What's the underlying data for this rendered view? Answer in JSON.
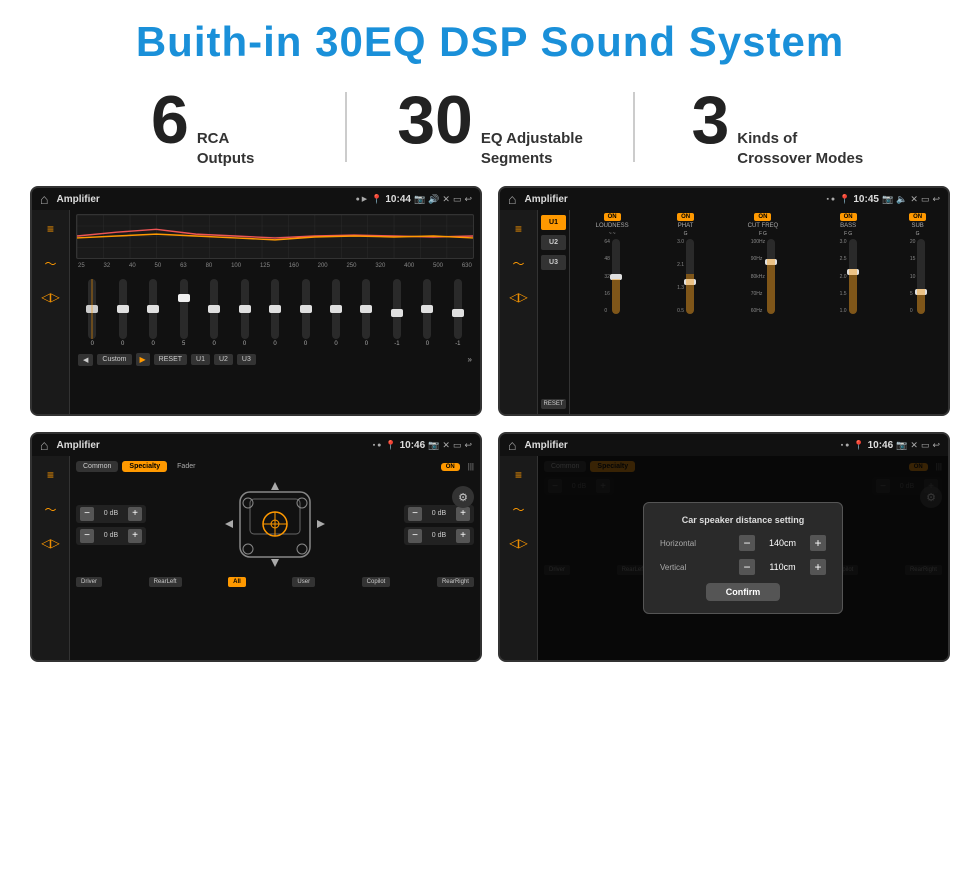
{
  "header": {
    "title": "Buith-in 30EQ DSP Sound System"
  },
  "stats": [
    {
      "number": "6",
      "label": "RCA\nOutputs"
    },
    {
      "number": "30",
      "label": "EQ Adjustable\nSegments"
    },
    {
      "number": "3",
      "label": "Kinds of\nCrossover Modes"
    }
  ],
  "screen1": {
    "statusBar": {
      "title": "Amplifier",
      "time": "10:44"
    },
    "freqLabels": [
      "25",
      "32",
      "40",
      "50",
      "63",
      "80",
      "100",
      "125",
      "160",
      "200",
      "250",
      "320",
      "400",
      "500",
      "630"
    ],
    "sliderValues": [
      "0",
      "0",
      "0",
      "5",
      "0",
      "0",
      "0",
      "0",
      "0",
      "0",
      "-1",
      "0",
      "-1"
    ],
    "preset": "Custom",
    "buttons": [
      "RESET",
      "U1",
      "U2",
      "U3"
    ]
  },
  "screen2": {
    "statusBar": {
      "title": "Amplifier",
      "time": "10:45"
    },
    "presets": [
      "U1",
      "U2",
      "U3"
    ],
    "controls": [
      {
        "label": "LOUDNESS",
        "on": true
      },
      {
        "label": "PHAT",
        "on": true
      },
      {
        "label": "CUT FREQ",
        "on": true
      },
      {
        "label": "BASS",
        "on": true
      },
      {
        "label": "SUB",
        "on": true
      }
    ],
    "resetLabel": "RESET"
  },
  "screen3": {
    "statusBar": {
      "title": "Amplifier",
      "time": "10:46"
    },
    "tabs": [
      "Common",
      "Specialty"
    ],
    "activeTab": "Specialty",
    "faderLabel": "Fader",
    "faderOn": "ON",
    "volumes": [
      "0 dB",
      "0 dB",
      "0 dB",
      "0 dB"
    ],
    "positions": [
      "Driver",
      "RearLeft",
      "All",
      "User",
      "Copilot",
      "RearRight"
    ]
  },
  "screen4": {
    "statusBar": {
      "title": "Amplifier",
      "time": "10:46"
    },
    "tabs": [
      "Common",
      "Specialty"
    ],
    "dialog": {
      "title": "Car speaker distance setting",
      "fields": [
        {
          "label": "Horizontal",
          "value": "140cm"
        },
        {
          "label": "Vertical",
          "value": "110cm"
        }
      ],
      "confirmLabel": "Confirm"
    },
    "volumes": [
      "0 dB",
      "0 dB"
    ],
    "positions": [
      "Driver",
      "RearLeft",
      "All",
      "User",
      "Copilot",
      "RearRight"
    ]
  },
  "colors": {
    "accent": "#f90",
    "blue": "#1a90d9",
    "dark": "#1a1a1a",
    "darker": "#111"
  }
}
